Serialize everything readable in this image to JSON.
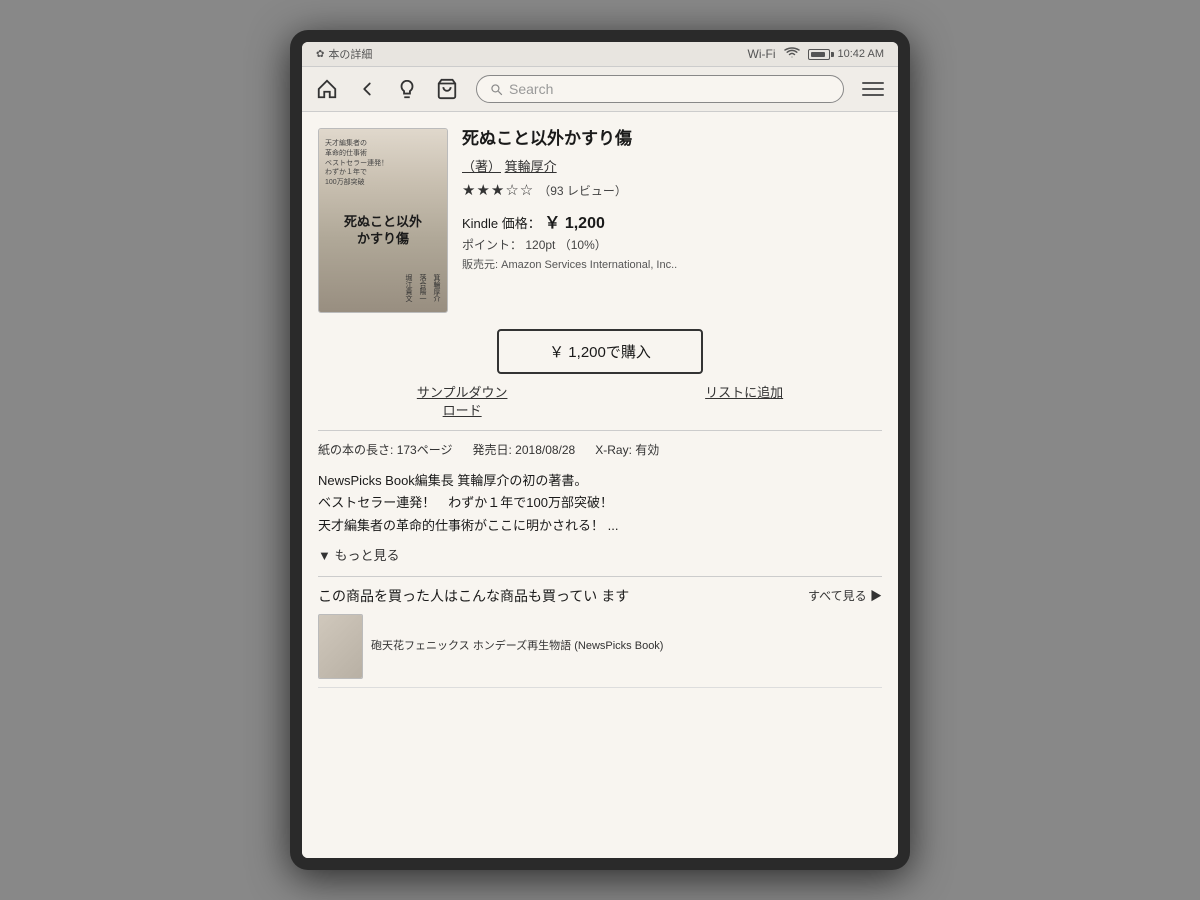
{
  "device": {
    "status_bar": {
      "icon": "✿",
      "title": "本の詳細",
      "wifi_label": "Wi-Fi",
      "time": "10:42 AM"
    }
  },
  "nav": {
    "home_label": "⌂",
    "back_label": "〈",
    "lightbulb_label": "☆",
    "cart_label": "🛒",
    "search_placeholder": "Search",
    "menu_label": "≡"
  },
  "book": {
    "title": "死ぬこと以外かすり傷",
    "author_label": "（著）",
    "author_name": "箕輪厚介",
    "stars": "★★★☆☆",
    "review_count": "（93 レビュー）",
    "kindle_price_label": "Kindle 価格：",
    "kindle_price": "￥ 1,200",
    "points_label": "ポイント：",
    "points": "120pt",
    "points_percent": "（10%）",
    "seller_label": "販売元:",
    "seller": "Amazon Services International, Inc..",
    "buy_button": "￥ 1,200で購入",
    "sample_download": "サンプルダウン\nロード",
    "add_to_list": "リストに追加",
    "pages_label": "紙の本の長さ:",
    "pages": "173ページ",
    "release_label": "発売日:",
    "release_date": "2018/08/28",
    "xray_label": "X-Ray:",
    "xray_status": "有効",
    "description_line1": "NewsPicks Book編集長 箕輪厚介の初の著書。",
    "description_line2": "ベストセラー連発！　わずか１年で100万部突破！",
    "description_line3": "天才編集者の革命的仕事術がここに明かされる！ ...",
    "more_label": "▼ もっと見る",
    "related_section_title": "この商品を買った人はこんな商品も買ってい\nます",
    "see_all_label": "すべて見る ▶",
    "related_book_title": "砲天花フェニックス ホンデーズ再生物語 (NewsPicks Book)"
  }
}
